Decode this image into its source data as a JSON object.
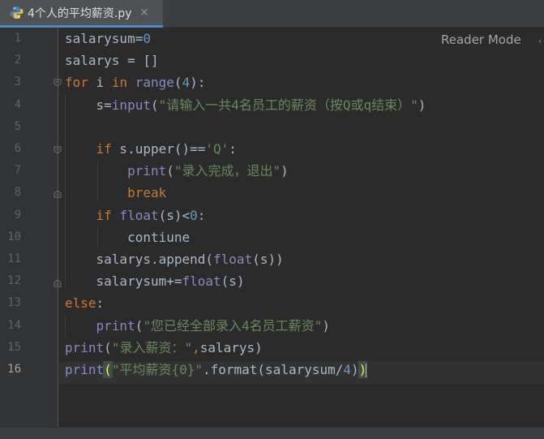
{
  "tab": {
    "title": "4个人的平均薪资.py",
    "close": "×"
  },
  "editor": {
    "reader_mode": "Reader Mode",
    "line_numbers": [
      "1",
      "2",
      "3",
      "4",
      "5",
      "6",
      "7",
      "8",
      "9",
      "10",
      "11",
      "12",
      "13",
      "14",
      "15",
      "16"
    ],
    "current_line": 16,
    "lines": [
      [
        {
          "t": "salarysum=",
          "c": "txt"
        },
        {
          "t": "0",
          "c": "num"
        }
      ],
      [
        {
          "t": "salarys = []",
          "c": "txt"
        }
      ],
      [
        {
          "t": "for",
          "c": "kw"
        },
        {
          "t": " i ",
          "c": "txt"
        },
        {
          "t": "in",
          "c": "kw"
        },
        {
          "t": " ",
          "c": "txt"
        },
        {
          "t": "range",
          "c": "bi"
        },
        {
          "t": "(",
          "c": "txt"
        },
        {
          "t": "4",
          "c": "num"
        },
        {
          "t": "):",
          "c": "txt"
        }
      ],
      [
        {
          "t": "    s=",
          "c": "txt"
        },
        {
          "t": "input",
          "c": "bi"
        },
        {
          "t": "(",
          "c": "txt"
        },
        {
          "t": "\"请输入一共4名员工的薪资（按Q或q结束）\"",
          "c": "str"
        },
        {
          "t": ")",
          "c": "txt"
        }
      ],
      [],
      [
        {
          "t": "    ",
          "c": "txt"
        },
        {
          "t": "if",
          "c": "kw"
        },
        {
          "t": " s.upper()==",
          "c": "txt"
        },
        {
          "t": "'Q'",
          "c": "str"
        },
        {
          "t": ":",
          "c": "txt"
        }
      ],
      [
        {
          "t": "        ",
          "c": "txt"
        },
        {
          "t": "print",
          "c": "bi"
        },
        {
          "t": "(",
          "c": "txt"
        },
        {
          "t": "\"录入完成，退出\"",
          "c": "str"
        },
        {
          "t": ")",
          "c": "txt"
        }
      ],
      [
        {
          "t": "        ",
          "c": "txt"
        },
        {
          "t": "break",
          "c": "kw"
        }
      ],
      [
        {
          "t": "    ",
          "c": "txt"
        },
        {
          "t": "if",
          "c": "kw"
        },
        {
          "t": " ",
          "c": "txt"
        },
        {
          "t": "float",
          "c": "bi"
        },
        {
          "t": "(s)<",
          "c": "txt"
        },
        {
          "t": "0",
          "c": "num"
        },
        {
          "t": ":",
          "c": "txt"
        }
      ],
      [
        {
          "t": "        contiune",
          "c": "txt"
        }
      ],
      [
        {
          "t": "    salarys.append(",
          "c": "txt"
        },
        {
          "t": "float",
          "c": "bi"
        },
        {
          "t": "(s))",
          "c": "txt"
        }
      ],
      [
        {
          "t": "    salarysum+=",
          "c": "txt"
        },
        {
          "t": "float",
          "c": "bi"
        },
        {
          "t": "(s)",
          "c": "txt"
        }
      ],
      [
        {
          "t": "else",
          "c": "kw"
        },
        {
          "t": ":",
          "c": "txt"
        }
      ],
      [
        {
          "t": "    ",
          "c": "txt"
        },
        {
          "t": "print",
          "c": "bi"
        },
        {
          "t": "(",
          "c": "txt"
        },
        {
          "t": "\"您已经全部录入4名员工薪资\"",
          "c": "str"
        },
        {
          "t": ")",
          "c": "txt"
        }
      ],
      [
        {
          "t": "print",
          "c": "bi"
        },
        {
          "t": "(",
          "c": "txt"
        },
        {
          "t": "\"录入薪资：\"",
          "c": "str"
        },
        {
          "t": ",",
          "c": "kw"
        },
        {
          "t": "salarys)",
          "c": "txt"
        }
      ],
      [
        {
          "t": "print",
          "c": "bi"
        },
        {
          "t": "(",
          "c": "bracket-hl"
        },
        {
          "t": "\"平均薪资{0}\"",
          "c": "str"
        },
        {
          "t": ".format(salarysum/",
          "c": "txt"
        },
        {
          "t": "4",
          "c": "num"
        },
        {
          "t": ")",
          "c": "txt"
        },
        {
          "t": ")",
          "c": "bracket-hl"
        }
      ]
    ]
  },
  "colors": {
    "background": "#2b2b2b",
    "keyword": "#cc7832",
    "builtin": "#8888c6",
    "number": "#6897bb",
    "string": "#6a8759",
    "text": "#a9b7c6"
  },
  "icons": {
    "file": "python-file-icon",
    "fold_open": "fold-open-icon",
    "fold_end": "fold-end-icon"
  }
}
